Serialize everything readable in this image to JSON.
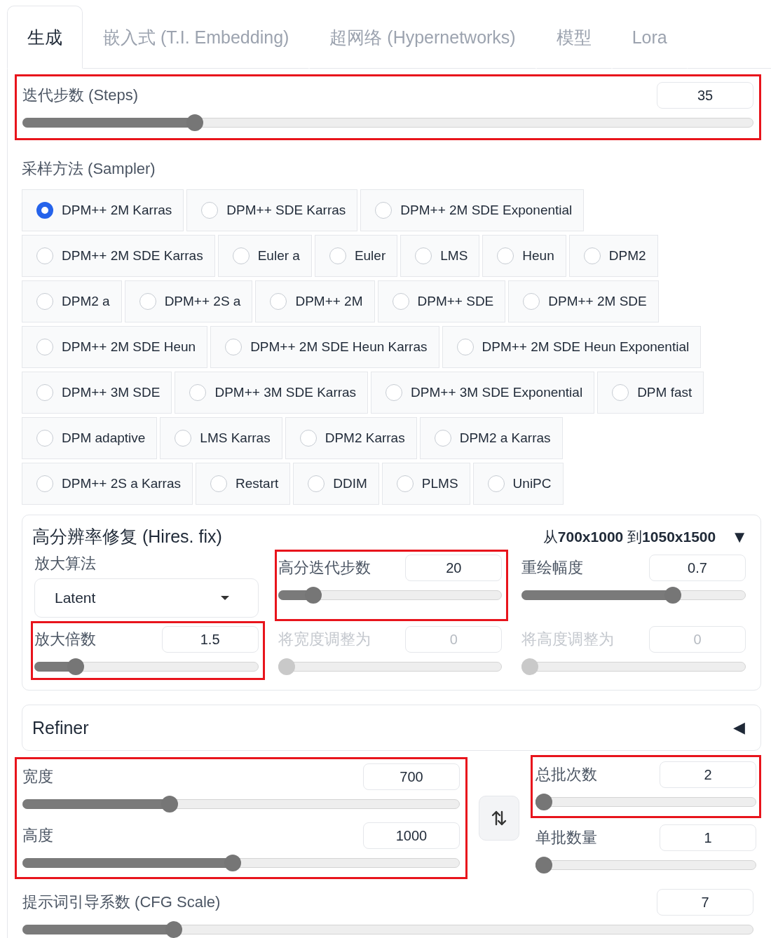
{
  "tabs": [
    {
      "label": "生成",
      "selected": true
    },
    {
      "label": "嵌入式 (T.I. Embedding)",
      "selected": false
    },
    {
      "label": "超网络 (Hypernetworks)",
      "selected": false
    },
    {
      "label": "模型",
      "selected": false
    },
    {
      "label": "Lora",
      "selected": false
    }
  ],
  "steps": {
    "label": "迭代步数 (Steps)",
    "value": "35",
    "level": 0.23,
    "highlighted": true,
    "disabled": false
  },
  "sampler": {
    "label": "采样方法 (Sampler)",
    "rows": [
      {
        "options": [
          {
            "label": "DPM++ 2M Karras",
            "selected": true
          },
          {
            "label": "DPM++ SDE Karras",
            "selected": false
          },
          {
            "label": "DPM++ 2M SDE Exponential",
            "selected": false
          }
        ]
      },
      {
        "options": [
          {
            "label": "DPM++ 2M SDE Karras",
            "selected": false
          },
          {
            "label": "Euler a",
            "selected": false
          },
          {
            "label": "Euler",
            "selected": false
          },
          {
            "label": "LMS",
            "selected": false
          },
          {
            "label": "Heun",
            "selected": false
          },
          {
            "label": "DPM2",
            "selected": false
          }
        ]
      },
      {
        "options": [
          {
            "label": "DPM2 a",
            "selected": false
          },
          {
            "label": "DPM++ 2S a",
            "selected": false
          },
          {
            "label": "DPM++ 2M",
            "selected": false
          },
          {
            "label": "DPM++ SDE",
            "selected": false
          },
          {
            "label": "DPM++ 2M SDE",
            "selected": false
          }
        ]
      },
      {
        "options": [
          {
            "label": "DPM++ 2M SDE Heun",
            "selected": false
          },
          {
            "label": "DPM++ 2M SDE Heun Karras",
            "selected": false
          },
          {
            "label": "DPM++ 2M SDE Heun Exponential",
            "selected": false
          }
        ]
      },
      {
        "options": [
          {
            "label": "DPM++ 3M SDE",
            "selected": false
          },
          {
            "label": "DPM++ 3M SDE Karras",
            "selected": false
          },
          {
            "label": "DPM++ 3M SDE Exponential",
            "selected": false
          },
          {
            "label": "DPM fast",
            "selected": false
          }
        ]
      },
      {
        "options": [
          {
            "label": "DPM adaptive",
            "selected": false
          },
          {
            "label": "LMS Karras",
            "selected": false
          },
          {
            "label": "DPM2 Karras",
            "selected": false
          },
          {
            "label": "DPM2 a Karras",
            "selected": false
          }
        ]
      },
      {
        "options": [
          {
            "label": "DPM++ 2S a Karras",
            "selected": false
          },
          {
            "label": "Restart",
            "selected": false
          },
          {
            "label": "DDIM",
            "selected": false
          },
          {
            "label": "PLMS",
            "selected": false
          },
          {
            "label": "UniPC",
            "selected": false
          }
        ]
      }
    ]
  },
  "hires_fix": {
    "title": "高分辨率修复 (Hires. fix)",
    "summary": "从**700x1000** 到**1050x1500**",
    "arrow": "▼",
    "upscaler": {
      "label": "放大算法",
      "value": "Latent"
    },
    "sliders": [
      {
        "label": "高分迭代步数",
        "value": "20",
        "level": 0.13,
        "highlighted": true,
        "disabled": false
      },
      {
        "label": "重绘幅度",
        "value": "0.7",
        "level": 0.69,
        "highlighted": false,
        "disabled": false
      },
      {
        "label": "放大倍数",
        "value": "1.5",
        "level": 0.16,
        "highlighted": true,
        "disabled": false
      },
      {
        "label": "将宽度调整为",
        "value": "0",
        "level": 0,
        "highlighted": false,
        "disabled": true
      },
      {
        "label": "将高度调整为",
        "value": "0",
        "level": 0,
        "highlighted": false,
        "disabled": true
      }
    ]
  },
  "refiner": {
    "title": "Refiner",
    "arrow": "◀"
  },
  "size": {
    "highlighted": true,
    "sliders": [
      {
        "label": "宽度",
        "value": "700",
        "level": 0.33,
        "disabled": false
      },
      {
        "label": "高度",
        "value": "1000",
        "level": 0.48,
        "disabled": false
      }
    ]
  },
  "batch": [
    {
      "label": "总批次数",
      "value": "2",
      "level": 0,
      "highlighted": true,
      "disabled": false
    },
    {
      "label": "单批数量",
      "value": "1",
      "level": 0,
      "highlighted": false,
      "disabled": false
    }
  ],
  "cfg": {
    "label": "提示词引导系数 (CFG Scale)",
    "value": "7",
    "level": 0.2,
    "highlighted": false,
    "disabled": false
  }
}
